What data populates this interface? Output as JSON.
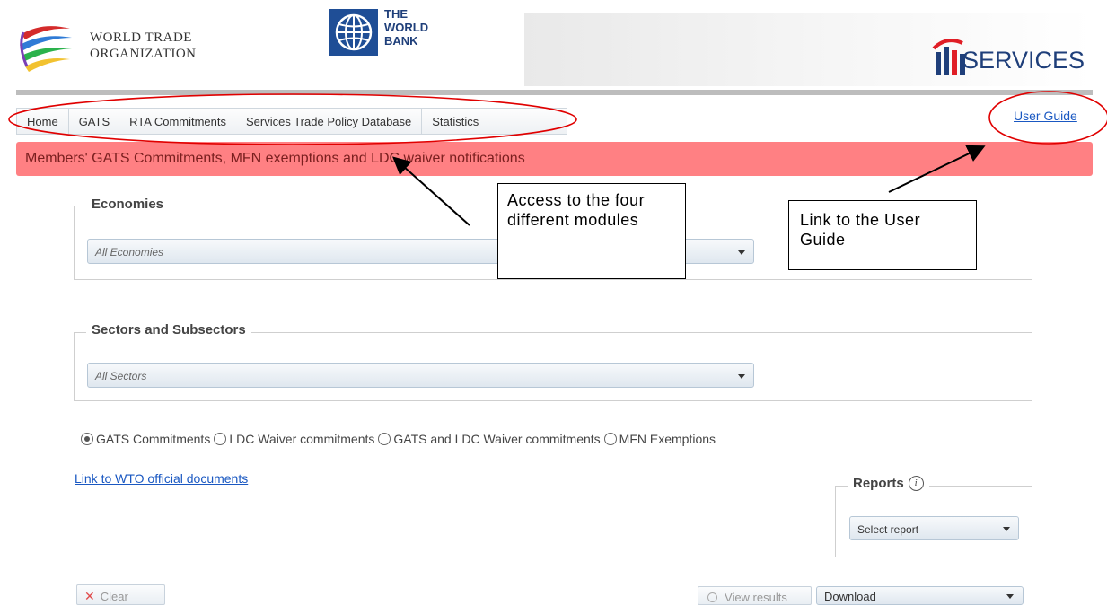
{
  "header": {
    "wto_line1": "WORLD TRADE",
    "wto_line2": "ORGANIZATION",
    "wb_line1": "THE",
    "wb_line2": "WORLD",
    "wb_line3": "BANK",
    "itip_label": "SERVICES",
    "wto_logo_icon": "wto-swirl-logo-icon",
    "wb_logo_icon": "world-bank-globe-icon",
    "itip_logo_icon": "i-tip-logo-icon"
  },
  "nav": {
    "items": [
      {
        "label": "Home"
      },
      {
        "label": "GATS"
      },
      {
        "label": "RTA Commitments"
      },
      {
        "label": "Services Trade Policy Database"
      },
      {
        "label": "Statistics"
      }
    ],
    "user_guide": "User Guide"
  },
  "title_band": "Members' GATS Commitments, MFN exemptions and LDC waiver notifications",
  "economies": {
    "legend": "Economies",
    "selected": "All Economies"
  },
  "sectors": {
    "legend": "Sectors and Subsectors",
    "selected": "All Sectors"
  },
  "radios": [
    {
      "label": "GATS Commitments",
      "checked": true
    },
    {
      "label": "LDC Waiver commitments",
      "checked": false
    },
    {
      "label": "GATS and LDC Waiver commitments",
      "checked": false
    },
    {
      "label": "MFN Exemptions",
      "checked": false
    }
  ],
  "wto_docs_link": "Link to WTO official documents",
  "reports": {
    "legend": "Reports",
    "info_icon": "info-icon",
    "selected": "Select report"
  },
  "buttons": {
    "clear": "Clear",
    "view_results": "View results",
    "download": "Download"
  },
  "annotations": {
    "modules_note": "Access to the four different modules",
    "guide_note": "Link to the User Guide"
  },
  "colors": {
    "title_band": "#ff8083",
    "link": "#1a58c2",
    "annotation": "#e00000"
  }
}
